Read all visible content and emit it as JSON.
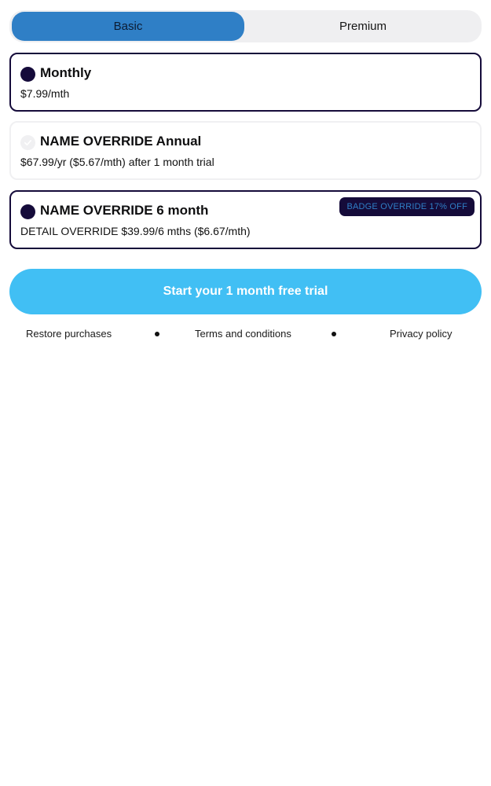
{
  "tiers": {
    "basic_label": "Basic",
    "premium_label": "Premium",
    "selected": "Basic"
  },
  "plans": [
    {
      "name": "Monthly",
      "detail": "$7.99/mth",
      "selected": false,
      "badge": ""
    },
    {
      "name": "NAME OVERRIDE Annual",
      "detail": "$67.99/yr ($5.67/mth) after 1 month trial",
      "selected": true,
      "badge": ""
    },
    {
      "name": "NAME OVERRIDE 6 month",
      "detail": "DETAIL OVERRIDE $39.99/6 mths ($6.67/mth)",
      "selected": false,
      "badge": "BADGE OVERRIDE 17% OFF"
    }
  ],
  "cta": {
    "label": "Start your 1 month free trial"
  },
  "footer": {
    "restore_label": "Restore purchases",
    "terms_label": "Terms and conditions",
    "privacy_label": "Privacy policy"
  },
  "colors": {
    "accent_blue": "#2f7fc6",
    "navy": "#150b3a",
    "cta_blue": "#41bff4",
    "toggle_bg": "#efeff1"
  },
  "icons": {
    "radio_selected": "check-circle-icon",
    "radio_unselected": "radio-dot-icon",
    "separator": "bullet-dot-icon"
  }
}
